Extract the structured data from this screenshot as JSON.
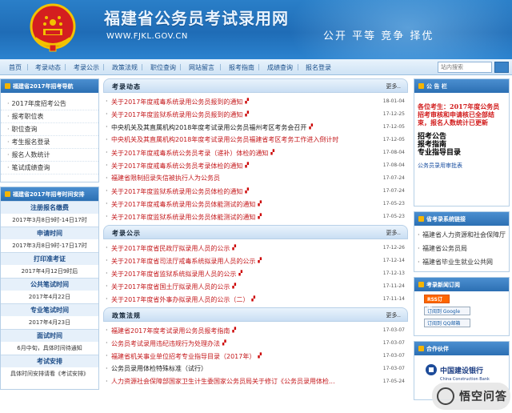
{
  "header": {
    "title": "福建省公务员考试录用网",
    "url": "WWW.FJKL.GOV.CN",
    "slogan": "公开 平等 竞争 择优"
  },
  "nav": {
    "items": [
      "首页",
      "考录动态",
      "考录公示",
      "政策法规",
      "职位查询",
      "网站留言",
      "报考指南",
      "成绩查询",
      "报名登录"
    ],
    "search_placeholder": "站内搜索"
  },
  "left": {
    "guide_title": "福建省2017年招考导航",
    "guide_items": [
      "2017年度招考公告",
      "报考职位表",
      "职位查询",
      "考生报名登录",
      "报名人数统计",
      "笔试成绩查询"
    ],
    "schedule_title": "福建省2017年招考时间安排",
    "schedule": [
      {
        "title": "注册报名缴费",
        "date": "2017年3月8日9时-14日17时"
      },
      {
        "title": "申请时间",
        "date": "2017年3月8日9时-17日17时"
      },
      {
        "title": "打印准考证",
        "date": "2017年4月12日9时后"
      },
      {
        "title": "公共笔试时间",
        "date": "2017年4月22日"
      },
      {
        "title": "专业笔试时间",
        "date": "2017年4月23日"
      },
      {
        "title": "面试时间",
        "date": "6月中旬，具体时间待通知"
      },
      {
        "title": "考试安排",
        "date": "具体时间安排请看《考试安排》"
      }
    ]
  },
  "center": {
    "more_label": "更多..",
    "sections": [
      {
        "title": "考录动态",
        "items": [
          {
            "text": "关于2017年度戒毒系统录用公务员报到的通知",
            "date": "18-01-04",
            "black": false,
            "new": true
          },
          {
            "text": "关于2017年度监狱系统录用公务员报到的通知",
            "date": "17-12-25",
            "black": false,
            "new": true
          },
          {
            "text": "中央机关及其直属机构2018年度考试录用公务员福州考区考务会召开",
            "date": "17-12-05",
            "black": true,
            "new": true
          },
          {
            "text": "中央机关及其直属机构2018年度考试录用公务员福建省考区考务工作进入倒计时",
            "date": "17-12-05",
            "black": false,
            "new": false
          },
          {
            "text": "关于2017年度戒毒系统公务员考录（递补）体检的通知",
            "date": "17-08-04",
            "black": false,
            "new": true
          },
          {
            "text": "关于2017年度戒毒系统公务员考录体检的通知",
            "date": "17-08-04",
            "black": false,
            "new": true
          },
          {
            "text": "福建省限制招录失信被执行人为公务员",
            "date": "17-07-24",
            "black": false,
            "new": false
          },
          {
            "text": "关于2017年度监狱系统录用公务员体检的通知",
            "date": "17-07-24",
            "black": false,
            "new": true
          },
          {
            "text": "关于2017年度戒毒系统录用公务员体能测试的通知",
            "date": "17-05-23",
            "black": false,
            "new": true
          },
          {
            "text": "关于2017年度监狱系统录用公务员体能测试的通知",
            "date": "17-05-23",
            "black": false,
            "new": true
          }
        ]
      },
      {
        "title": "考录公示",
        "items": [
          {
            "text": "关于2017年度省民政厅拟录用人员的公示",
            "date": "17-12-26",
            "black": false,
            "new": true
          },
          {
            "text": "关于2017年度省司法厅戒毒系统拟录用人员的公示",
            "date": "17-12-14",
            "black": false,
            "new": true
          },
          {
            "text": "关于2017年度省监狱系统拟录用人员的公示",
            "date": "17-12-13",
            "black": false,
            "new": true
          },
          {
            "text": "关于2017年度省国土厅拟录用人员的公示",
            "date": "17-11-24",
            "black": false,
            "new": true
          },
          {
            "text": "关于2017年度省外事办拟录用人员的公示（二）",
            "date": "17-11-14",
            "black": false,
            "new": true
          }
        ]
      },
      {
        "title": "政策法规",
        "items": [
          {
            "text": "福建省2017年度考试录用公务员报考指南",
            "date": "17-03-07",
            "black": false,
            "new": true
          },
          {
            "text": "公务员考试录用违纪违规行为处理办法",
            "date": "17-03-07",
            "black": false,
            "new": true
          },
          {
            "text": "福建省机关事业单位招考专业指导目录（2017年）",
            "date": "17-03-07",
            "black": false,
            "new": true
          },
          {
            "text": "公务员录用体检特殊标准（试行）",
            "date": "17-03-07",
            "black": true,
            "new": false
          },
          {
            "text": "人力资源社会保障部国家卫生计生委国家公务员局关于修订《公务员录用体检...",
            "date": "17-05-24",
            "black": false,
            "new": false
          }
        ]
      }
    ]
  },
  "right": {
    "notice_title": "公 告 栏",
    "notice_red": "各位考生：2017年度公务员招考审核和申请核已全部结束，报名人数统计已更新",
    "notice_items": [
      "招考公告",
      "报考指南",
      "专业指导目录"
    ],
    "notice_link": "公务员录用审批表",
    "links_title": "省考录系统链接",
    "links": [
      "福建省人力资源和社会保障厅",
      "福建省公务员局",
      "福建省毕业生就业公共网"
    ],
    "subscribe_title": "考录新闻订阅",
    "rss_label": "RSS订阅",
    "sub1_label": "订阅到 Google",
    "sub2_label": "订阅到 QQ邮箱",
    "partner_title": "合作伙伴",
    "partner_name": "中国建设银行",
    "partner_en": "China Construction Bank"
  },
  "watermark": "悟空问答",
  "colors": {
    "header_blue": "#2070b8",
    "link_red": "#c4191c",
    "nav_text": "#1b4f8a",
    "accent_gold": "#f5b400"
  }
}
